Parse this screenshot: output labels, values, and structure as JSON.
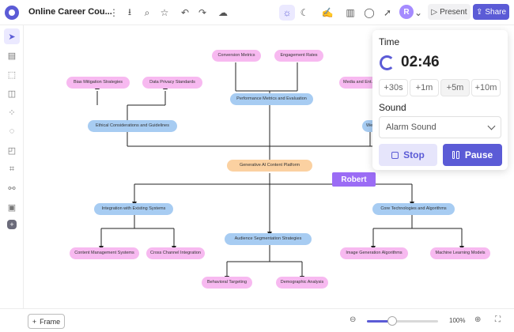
{
  "header": {
    "doc_title": "Online Career Cou...",
    "icons": [
      "more-vertical-icon",
      "download-icon",
      "search-icon",
      "star-icon",
      "undo-icon",
      "redo-icon",
      "cloud-icon",
      "sun-icon",
      "moon-icon",
      "handwriting-icon",
      "chart-icon",
      "comment-icon",
      "pointer-icon"
    ],
    "avatar_initial": "R",
    "present_label": "Present",
    "share_label": "Share"
  },
  "sidebar": {
    "icons": [
      "cursor-icon",
      "template-icon",
      "frame-icon",
      "shape-icon",
      "components-icon",
      "comment-icon",
      "sticky-note-icon",
      "crop-icon",
      "connector-icon",
      "media-icon",
      "plus-icon"
    ]
  },
  "mindmap": {
    "root": "Generative AI Content Platform",
    "nodes": {
      "conversion": "Conversion Metrics",
      "engagement": "Engagement Rates",
      "performance": "Performance Metrics and Evaluation",
      "bias": "Bias Mitigation Strategies",
      "privacy": "Data Privacy Standards",
      "ethical": "Ethical Considerations and Guidelines",
      "media": "Media and Ent...",
      "web": "We...",
      "integration": "Integration with Existing Systems",
      "core": "Core Technologies and Algorithms",
      "audience": "Audience Segmentation Strategies",
      "cms": "Content Management Systems",
      "cross": "Cross Channel Integration",
      "image": "Image Generation Algorithms",
      "ml": "Machine Learning Models",
      "behavioral": "Behavioral Targeting",
      "demographic": "Demographic Analysis"
    }
  },
  "cursor": {
    "user": "Robert"
  },
  "timer": {
    "title": "Time",
    "time": "02:46",
    "increments": [
      "+30s",
      "+1m",
      "+5m",
      "+10m"
    ],
    "sound_label": "Sound",
    "sound_value": "Alarm Sound",
    "stop_label": "Stop",
    "pause_label": "Pause"
  },
  "footer": {
    "frame_label": "Frame",
    "zoom": "100%",
    "zoom_fraction": 0.35
  },
  "colors": {
    "accent": "#5b5bd6",
    "cursor": "#9b6cf5",
    "node_pink": "#f7b9f0",
    "node_blue": "#a7ccf2",
    "node_orange": "#fbd1a1"
  }
}
